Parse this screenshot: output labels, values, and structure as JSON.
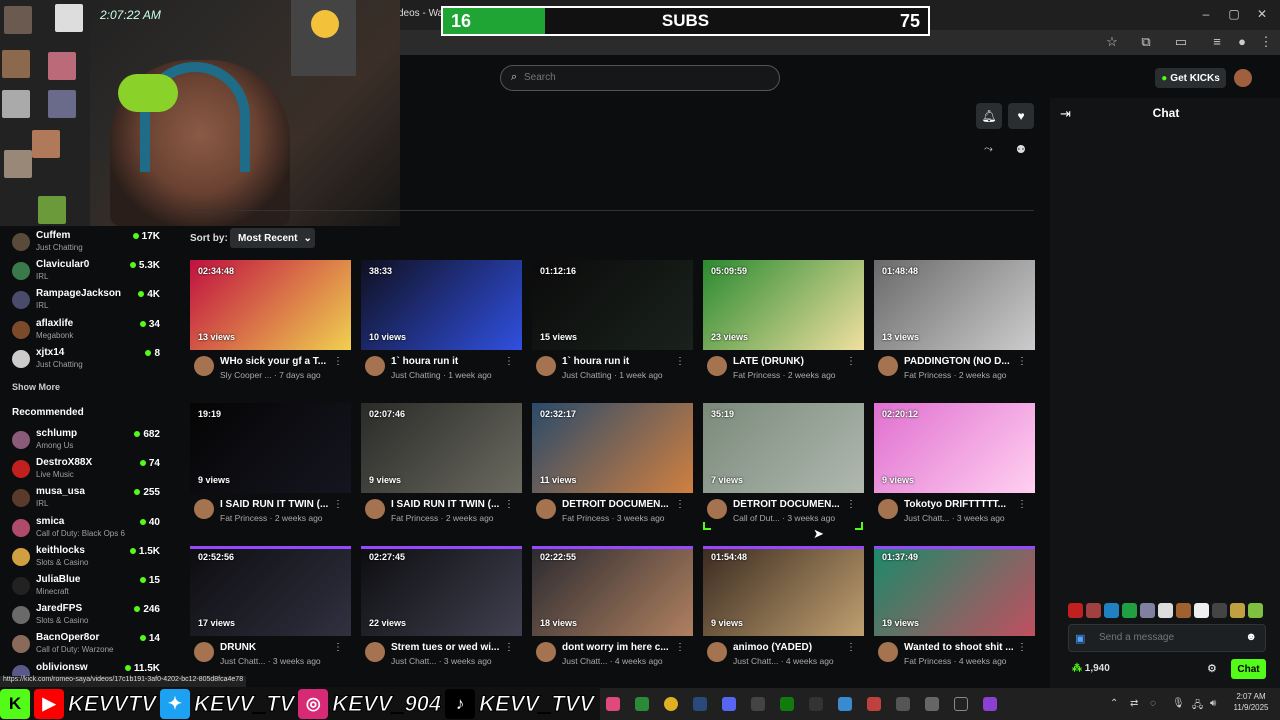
{
  "browser": {
    "tab_title": "deos - Wat",
    "status_url": "https://kick.com/romeo-saya/videos/17c1b191-3af0-4202-bc12-805d8fca4e78"
  },
  "overlay": {
    "subs_left": "16",
    "subs_label": "SUBS",
    "subs_right": "75",
    "subs_fraction": 0.21,
    "clock": "2:07:22 AM"
  },
  "header": {
    "search_placeholder": "Search",
    "get_kicks_label": "Get KICKs"
  },
  "sidebar": {
    "following": [
      {
        "name": "Cuffem",
        "category": "Just Chatting",
        "viewers": "17K",
        "avatar_color": "#5a4a3a"
      },
      {
        "name": "Clavicular0",
        "category": "IRL",
        "viewers": "5.3K",
        "avatar_color": "#3a7a4a"
      },
      {
        "name": "RampageJackson",
        "category": "IRL",
        "viewers": "4K",
        "avatar_color": "#4a4a6a"
      },
      {
        "name": "aflaxlife",
        "category": "Megabonk",
        "viewers": "34",
        "avatar_color": "#7a4a2a"
      },
      {
        "name": "xjtx14",
        "category": "Just Chatting",
        "viewers": "8",
        "avatar_color": "#cccccc"
      }
    ],
    "show_more_label": "Show More",
    "recommended_title": "Recommended",
    "recommended": [
      {
        "name": "schlump",
        "category": "Among Us",
        "viewers": "682",
        "avatar_color": "#8a5a7a"
      },
      {
        "name": "DestroX88X",
        "category": "Live Music",
        "viewers": "74",
        "avatar_color": "#c02020"
      },
      {
        "name": "musa_usa",
        "category": "IRL",
        "viewers": "255",
        "avatar_color": "#5a3a2a"
      },
      {
        "name": "smica",
        "category": "Call of Duty: Black Ops 6",
        "viewers": "40",
        "avatar_color": "#b04a6a"
      },
      {
        "name": "keithlocks",
        "category": "Slots & Casino",
        "viewers": "1.5K",
        "avatar_color": "#d0a040"
      },
      {
        "name": "JuliaBlue",
        "category": "Minecraft",
        "viewers": "15",
        "avatar_color": "#222222"
      },
      {
        "name": "JaredFPS",
        "category": "Slots & Casino",
        "viewers": "246",
        "avatar_color": "#6a6a6a"
      },
      {
        "name": "BacnOper8or",
        "category": "Call of Duty: Warzone",
        "viewers": "14",
        "avatar_color": "#8a6a5a"
      },
      {
        "name": "oblivionsw",
        "category": "",
        "viewers": "11.5K",
        "avatar_color": "#5a5a8a"
      }
    ]
  },
  "videos": {
    "sort_label": "Sort by:",
    "sort_value": "Most Recent",
    "items": [
      {
        "duration": "02:34:48",
        "views": "13 views",
        "title": "WHo sick your gf a T...",
        "channel": "Sly Cooper ...",
        "age": "7 days ago",
        "color1": "#c01040",
        "color2": "#f0d050"
      },
      {
        "duration": "38:33",
        "views": "10 views",
        "title": "1` houra run it",
        "channel": "Just Chatting",
        "age": "1 week ago",
        "color1": "#101020",
        "color2": "#3050e0"
      },
      {
        "duration": "01:12:16",
        "views": "15 views",
        "title": "1` houra run it",
        "channel": "Just Chatting",
        "age": "1 week ago",
        "color1": "#0b0b0b",
        "color2": "#1a221c"
      },
      {
        "duration": "05:09:59",
        "views": "23 views",
        "title": "LATE (DRUNK)",
        "channel": "Fat Princess",
        "age": "2 weeks ago",
        "color1": "#2a8a30",
        "color2": "#f0e0a0"
      },
      {
        "duration": "01:48:48",
        "views": "13 views",
        "title": "PADDINGTON (NO D...",
        "channel": "Fat Princess",
        "age": "2 weeks ago",
        "color1": "#6a6a6a",
        "color2": "#cccccc"
      },
      {
        "duration": "19:19",
        "views": "9 views",
        "title": "I SAID RUN IT TWIN (...",
        "channel": "Fat Princess",
        "age": "2 weeks ago",
        "color1": "#050505",
        "color2": "#151520"
      },
      {
        "duration": "02:07:46",
        "views": "9 views",
        "title": "I SAID RUN IT TWIN (...",
        "channel": "Fat Princess",
        "age": "2 weeks ago",
        "color1": "#2a2a28",
        "color2": "#6a6a60"
      },
      {
        "duration": "02:32:17",
        "views": "11 views",
        "title": "DETROIT DOCUMEN...",
        "channel": "Fat Princess",
        "age": "3 weeks ago",
        "color1": "#2a4a6a",
        "color2": "#d08040"
      },
      {
        "duration": "35:19",
        "views": "7 views",
        "title": "DETROIT DOCUMEN...",
        "channel": "Call of Dut...",
        "age": "3 weeks ago",
        "color1": "#7a8a7a",
        "color2": "#b0b8b0"
      },
      {
        "duration": "02:20:12",
        "views": "9 views",
        "title": "Tokotyo DRIFTTTTT...",
        "channel": "Just Chatt...",
        "age": "3 weeks ago",
        "color1": "#e070d0",
        "color2": "#ffd0f0"
      },
      {
        "duration": "02:52:56",
        "views": "17 views",
        "title": "DRUNK",
        "channel": "Just Chatt...",
        "age": "3 weeks ago",
        "color1": "#0d0d10",
        "color2": "#303040"
      },
      {
        "duration": "02:27:45",
        "views": "22 views",
        "title": "Strem tues or wed wi...",
        "channel": "Just Chatt...",
        "age": "3 weeks ago",
        "color1": "#0d0d10",
        "color2": "#404050"
      },
      {
        "duration": "02:22:55",
        "views": "18 views",
        "title": "dont worry im here c...",
        "channel": "Just Chatt...",
        "age": "4 weeks ago",
        "color1": "#2a2a30",
        "color2": "#b08060"
      },
      {
        "duration": "01:54:48",
        "views": "9 views",
        "title": "animoo (YADED)",
        "channel": "Just Chatt...",
        "age": "4 weeks ago",
        "color1": "#3a2a20",
        "color2": "#c0a070"
      },
      {
        "duration": "01:37:49",
        "views": "19 views",
        "title": "Wanted to shoot shit ...",
        "channel": "Fat Princess",
        "age": "4 weeks ago",
        "color1": "#1a8a6a",
        "color2": "#c05060"
      }
    ]
  },
  "chat": {
    "title": "Chat",
    "input_placeholder": "Send a message",
    "points": "1,940",
    "send_label": "Chat"
  },
  "banner": {
    "items": [
      {
        "icon": "kick-logo-icon",
        "text": "",
        "color": "#53fc18"
      },
      {
        "icon": "youtube-icon",
        "text": "KEVVTV",
        "color": "#ff0000"
      },
      {
        "icon": "twitter-icon",
        "text": "KEVV_TV",
        "color": "#1da1f2"
      },
      {
        "icon": "instagram-icon",
        "text": "KEVV_904",
        "color": "#d62976"
      },
      {
        "icon": "tiktok-icon",
        "text": "KEVV_TVV",
        "color": "#000000"
      }
    ]
  },
  "taskbar": {
    "time": "2:07 AM",
    "date": "11/9/2025"
  }
}
